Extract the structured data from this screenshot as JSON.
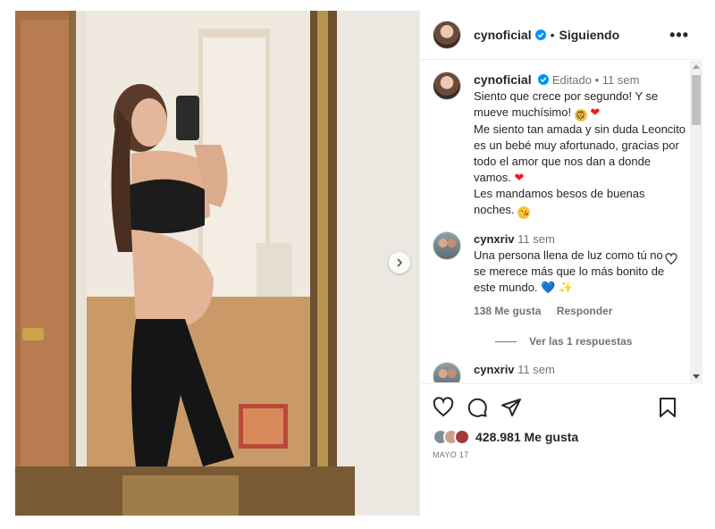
{
  "post": {
    "username": "cynoficial",
    "follow_status": "Siguiendo",
    "more_label": "•••"
  },
  "caption": {
    "username": "cynoficial",
    "edited": "Editado",
    "time": "11 sem",
    "line1": "Siento que crece por segundo! Y se mueve muchísimo!",
    "line2": "Me siento tan amada y sin duda Leoncito es un bebé muy afortunado, gracias por todo el amor que nos dan a donde vamos.",
    "line3": "Les mandamos besos de buenas noches."
  },
  "comments": [
    {
      "username": "cynxriv",
      "time": "11 sem",
      "text": "Una persona llena de luz como tú no se merece más que lo más bonito de este mundo.",
      "likes": "138 Me gusta",
      "reply": "Responder",
      "view_replies": "Ver las 1 respuestas"
    },
    {
      "username": "cynxriv",
      "time": "11 sem"
    }
  ],
  "footer": {
    "likes": "428.981 Me gusta",
    "date": "MAYO 17"
  },
  "colors": {
    "verified": "#0095f6",
    "heart": "#ed1c24",
    "blue_heart": "#1877f2"
  },
  "icons": [
    "verified-icon",
    "more-icon",
    "heart-icon",
    "comment-icon",
    "share-icon",
    "save-icon",
    "chevron-right-icon"
  ]
}
